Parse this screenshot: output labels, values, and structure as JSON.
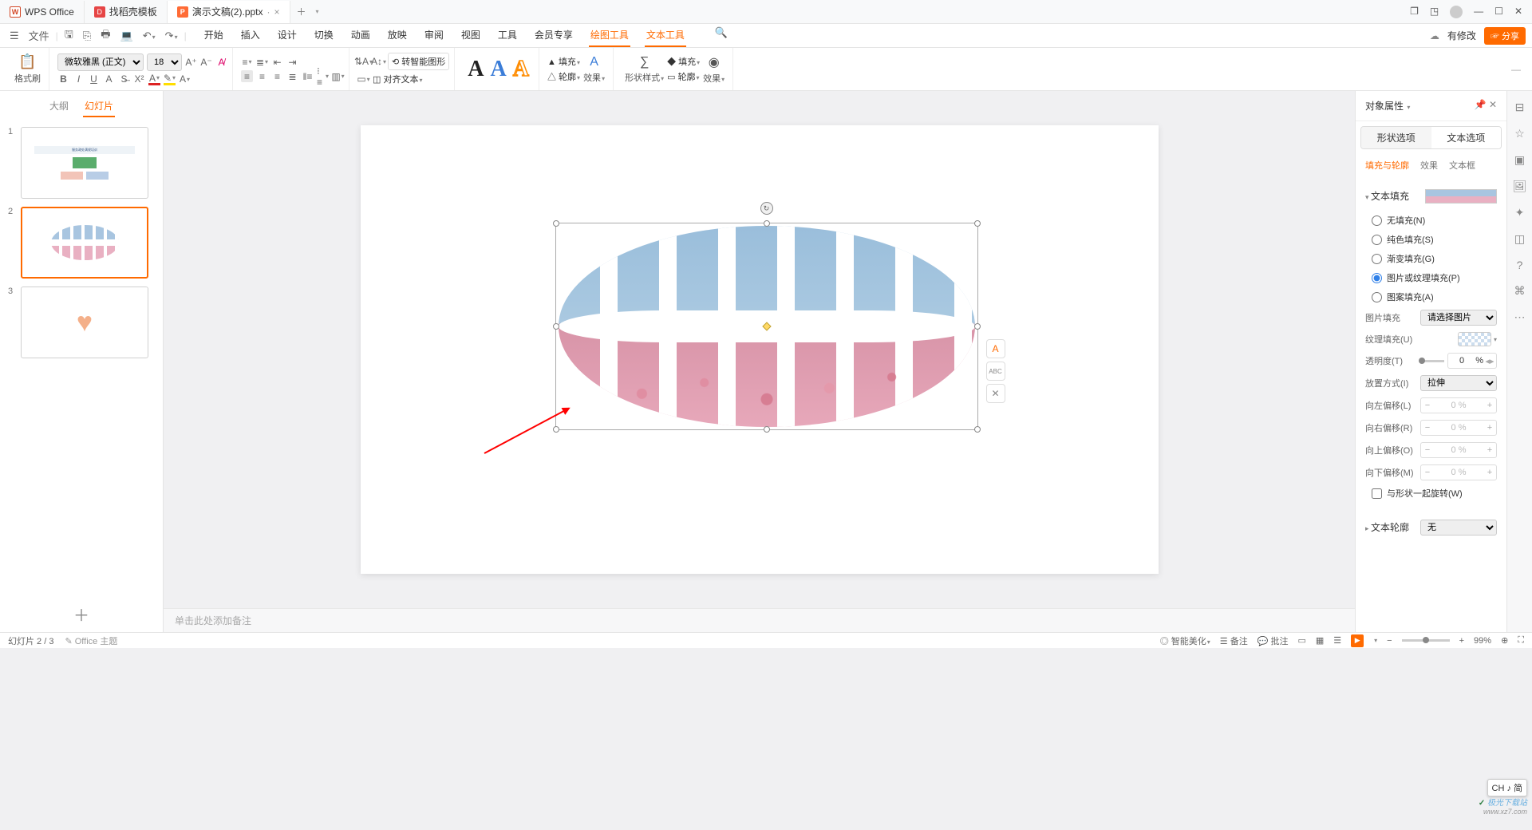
{
  "titlebar": {
    "tabs": [
      {
        "icon": "wps",
        "label": "WPS Office"
      },
      {
        "icon": "d",
        "label": "找稻壳模板"
      },
      {
        "icon": "p",
        "label": "演示文稿(2).pptx",
        "active": true,
        "dirty": "·"
      }
    ]
  },
  "quickbar": {
    "file_label": "文件"
  },
  "menus": {
    "items": [
      "开始",
      "插入",
      "设计",
      "切换",
      "动画",
      "放映",
      "审阅",
      "视图",
      "工具",
      "会员专享",
      "绘图工具",
      "文本工具"
    ],
    "active": [
      10,
      11
    ],
    "has_changes": "有修改",
    "share": "分享"
  },
  "ribbon": {
    "format_painter": "格式刷",
    "font_name": "微软雅黑 (正文)",
    "font_size": "18",
    "smart_shape": "转智能图形",
    "fill": "填充",
    "outline": "轮廓",
    "effect": "效果",
    "shape_style": "形状样式",
    "shape_outline": "轮廓",
    "shape_effect": "效果",
    "shape_fill": "填充",
    "align_text": "对齐文本"
  },
  "panel": {
    "tabs": [
      "大纲",
      "幻灯片"
    ],
    "active": 1
  },
  "notes_placeholder": "单击此处添加备注",
  "props": {
    "title": "对象属性",
    "tabs": [
      "形状选项",
      "文本选项"
    ],
    "tab_active": 1,
    "sections": [
      "填充与轮廓",
      "效果",
      "文本框"
    ],
    "sec_active": 0,
    "text_fill": "文本填充",
    "radios": [
      "无填充(N)",
      "纯色填充(S)",
      "渐变填充(G)",
      "图片或纹理填充(P)",
      "图案填充(A)"
    ],
    "radio_sel": 3,
    "pic_fill": "图片填充",
    "pic_fill_val": "请选择图片",
    "tex_fill": "纹理填充(U)",
    "opacity": "透明度(T)",
    "opacity_val": "0",
    "opacity_unit": "%",
    "place": "放置方式(I)",
    "place_val": "拉伸",
    "off_l": "向左偏移(L)",
    "off_r": "向右偏移(R)",
    "off_t": "向上偏移(O)",
    "off_b": "向下偏移(M)",
    "off_val": "0 %",
    "rotate_chk": "与形状一起旋转(W)",
    "text_outline": "文本轮廓",
    "text_outline_val": "无"
  },
  "statusbar": {
    "slide_info": "幻灯片 2 / 3",
    "theme": "Office 主题",
    "ai": "智能美化",
    "notes": "备注",
    "critique": "批注",
    "zoom": "99%"
  },
  "lang": "CH ♪ 简",
  "wm": {
    "a": "极光下载站",
    "b": "www.xz7.com"
  }
}
